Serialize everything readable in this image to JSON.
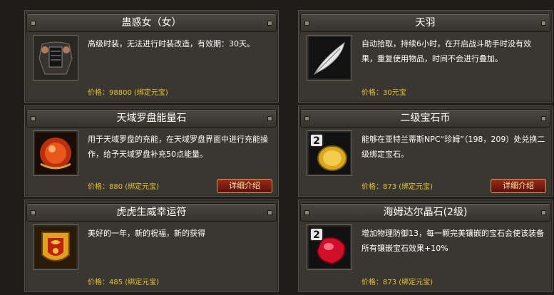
{
  "items": [
    {
      "title": "蛊惑女（女）",
      "desc": "高级时装，无法进行时装改造，有效期：30天。",
      "price_label": "价格：",
      "price_value": "98800 (绑定元宝)",
      "icon": "armor-icon"
    },
    {
      "title": "天羽",
      "desc": "自动拾取，持续6小时，在开启战斗助手时没有效果，重复使用物品，时间不会进行叠加。",
      "price_label": "价格：",
      "price_value": "30元宝",
      "icon": "feather-icon"
    },
    {
      "title": "天域罗盘能量石",
      "desc": "用于天域罗盘的充能，在天域罗盘界面中进行充能操作，给予天域罗盘补充50点能量。",
      "price_label": "价格：",
      "price_value": "880 (绑定元宝)",
      "detail_label": "详细介绍",
      "icon": "energy-stone-icon"
    },
    {
      "title": "二级宝石币",
      "desc": "能够在亚特兰蒂斯NPC“珍姆”（198，209）处兑换二级绑定宝石。",
      "price_label": "价格：",
      "price_value": "873 (绑定元宝)",
      "detail_label": "详细介绍",
      "icon": "gem-coin-icon",
      "badge": "2"
    },
    {
      "title": "虎虎生威幸运符",
      "desc": "美好的一年，新的祝福，新的获得",
      "price_label": "价格：",
      "price_value": "485 (绑定元宝)",
      "icon": "lucky-charm-icon"
    },
    {
      "title": "海姆达尔晶石(2级)",
      "desc": "增加物理防御13，每一颗完美镶嵌的宝石会使该装备所有镶嵌宝石效果+10%",
      "price_label": "价格：",
      "price_value": "873 (绑定元宝)",
      "icon": "red-gem-icon",
      "badge": "2"
    }
  ]
}
